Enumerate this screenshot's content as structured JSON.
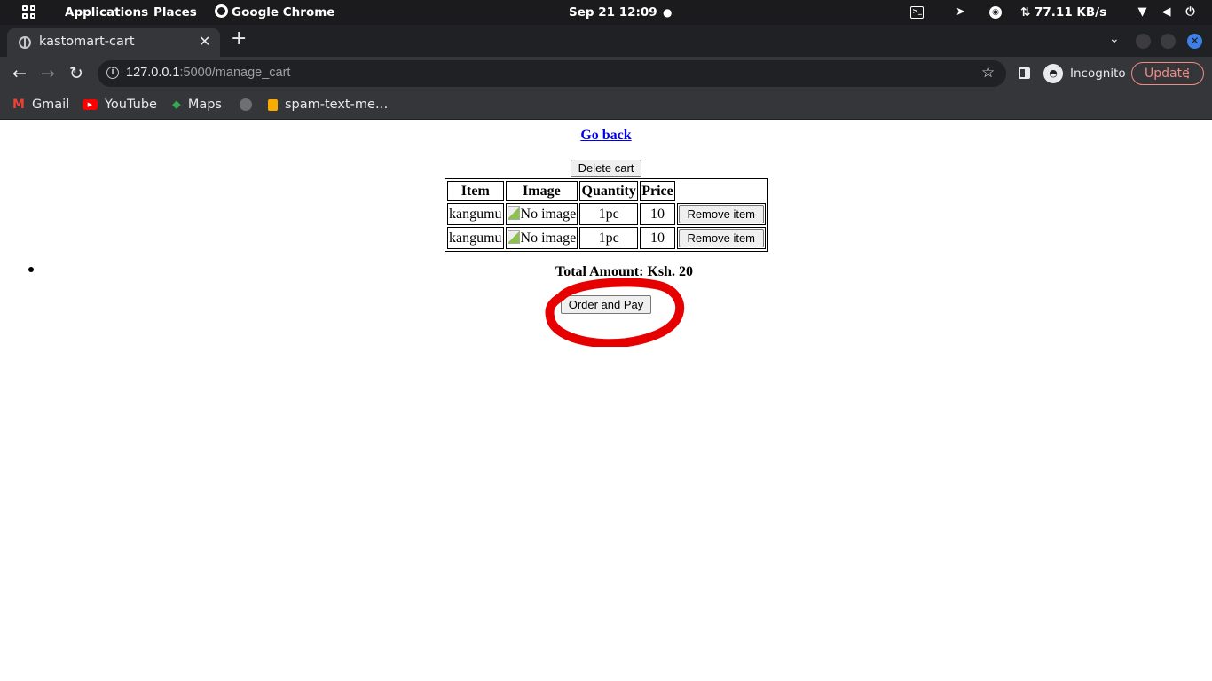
{
  "system_bar": {
    "apps_label": "Applications",
    "places_label": "Places",
    "active_app": "Google Chrome",
    "datetime": "Sep 21  12:09",
    "network_speed": "⇅ 77.11 KB/s"
  },
  "browser": {
    "tab_title": "kastomart-cart",
    "url_host": "127.0.0.1",
    "url_path": ":5000/manage_cart",
    "incognito_label": "Incognito",
    "update_label": "Update",
    "bookmarks": [
      {
        "label": "Gmail",
        "icon": "gmail-icon"
      },
      {
        "label": "YouTube",
        "icon": "youtube-icon"
      },
      {
        "label": "Maps",
        "icon": "maps-icon"
      },
      {
        "label": "spam-text-me…",
        "icon": "bookmark-icon"
      }
    ]
  },
  "page": {
    "go_back": "Go back",
    "delete_cart": "Delete cart",
    "table": {
      "headers": [
        "Item",
        "Image",
        "Quantity",
        "Price"
      ],
      "rows": [
        {
          "item": "kangumu",
          "image_alt": "No image",
          "quantity": "1pc",
          "price": "10",
          "action": "Remove item"
        },
        {
          "item": "kangumu",
          "image_alt": "No image",
          "quantity": "1pc",
          "price": "10",
          "action": "Remove item"
        }
      ]
    },
    "total": "Total Amount: Ksh. 20",
    "order_button": "Order and Pay"
  },
  "colors": {
    "link": "#0000ee",
    "annotation": "#e60000",
    "update_accent": "#f28b82"
  }
}
